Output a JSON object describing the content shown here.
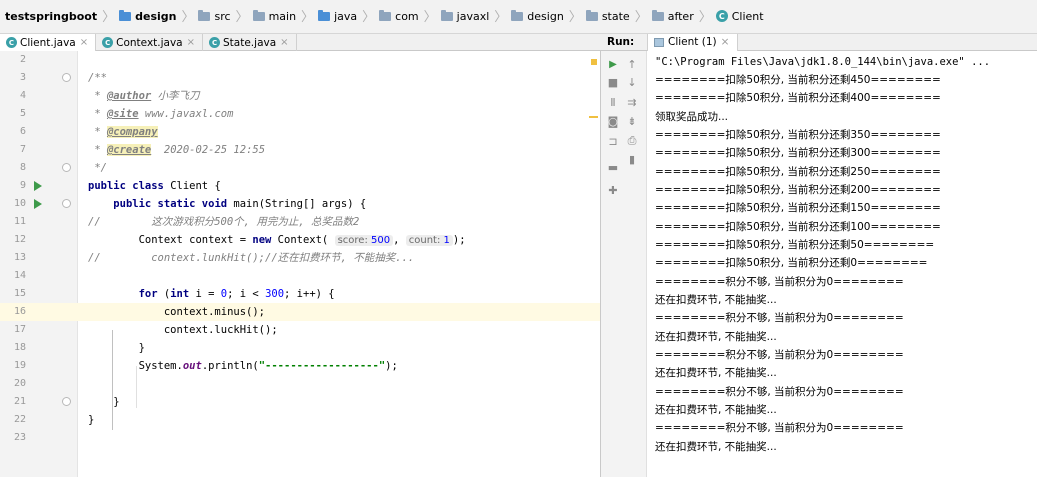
{
  "breadcrumb": [
    "testspringboot",
    "design",
    "src",
    "main",
    "java",
    "com",
    "javaxl",
    "design",
    "state",
    "after",
    "Client"
  ],
  "tabs": [
    "Client.java",
    "Context.java",
    "State.java"
  ],
  "run": {
    "label": "Run:",
    "tab": "Client (1)"
  },
  "editor": {
    "line_numbers": [
      "2",
      "3",
      "4",
      "5",
      "6",
      "7",
      "8",
      "9",
      "10",
      "11",
      "12",
      "13",
      "14",
      "15",
      "16",
      "17",
      "18",
      "19",
      "20",
      "21",
      "22",
      "23"
    ],
    "author_tag": "@author",
    "author_value": "小李飞刀",
    "site_tag": "@site",
    "site_value": "www.javaxl.com",
    "company_tag": "@company",
    "create_tag": "@create",
    "create_value": "2020-02-25 12:55",
    "class_decl": "Client {",
    "main_sig": "main(String[] args) {",
    "comment_game": "这次游戏积分500个, 用完为止, 总奖品数2",
    "context_decl": "Context context = ",
    "context_new": "Context(",
    "hint_score": "score:",
    "val_score": "500",
    "hint_count": "count:",
    "val_count": "1",
    "comment_lunk": "context.lunkHit();//还在扣费环节, 不能抽奖...",
    "for_head_a": "(",
    "for_var": "i = ",
    "for_zero": "0",
    "for_mid": "; i < ",
    "for_limit": "300",
    "for_tail": "; i++) {",
    "minus_call": "context.minus();",
    "luck_call": "context.luckHit();",
    "close_brace": "}",
    "sysout_a": "System.",
    "sysout_out": "out",
    "sysout_b": ".println(",
    "sysout_str": "\"------------------\"",
    "sysout_c": ");"
  },
  "console": [
    "\"C:\\Program Files\\Java\\jdk1.8.0_144\\bin\\java.exe\" ...",
    "========扣除50积分, 当前积分还剩450========",
    "========扣除50积分, 当前积分还剩400========",
    "领取奖品成功...",
    "========扣除50积分, 当前积分还剩350========",
    "========扣除50积分, 当前积分还剩300========",
    "========扣除50积分, 当前积分还剩250========",
    "========扣除50积分, 当前积分还剩200========",
    "========扣除50积分, 当前积分还剩150========",
    "========扣除50积分, 当前积分还剩100========",
    "========扣除50积分, 当前积分还剩50========",
    "========扣除50积分, 当前积分还剩0========",
    "========积分不够, 当前积分为0========",
    "还在扣费环节, 不能抽奖...",
    "========积分不够, 当前积分为0========",
    "还在扣费环节, 不能抽奖...",
    "========积分不够, 当前积分为0========",
    "还在扣费环节, 不能抽奖...",
    "========积分不够, 当前积分为0========",
    "还在扣费环节, 不能抽奖...",
    "========积分不够, 当前积分为0========",
    "还在扣费环节, 不能抽奖..."
  ]
}
